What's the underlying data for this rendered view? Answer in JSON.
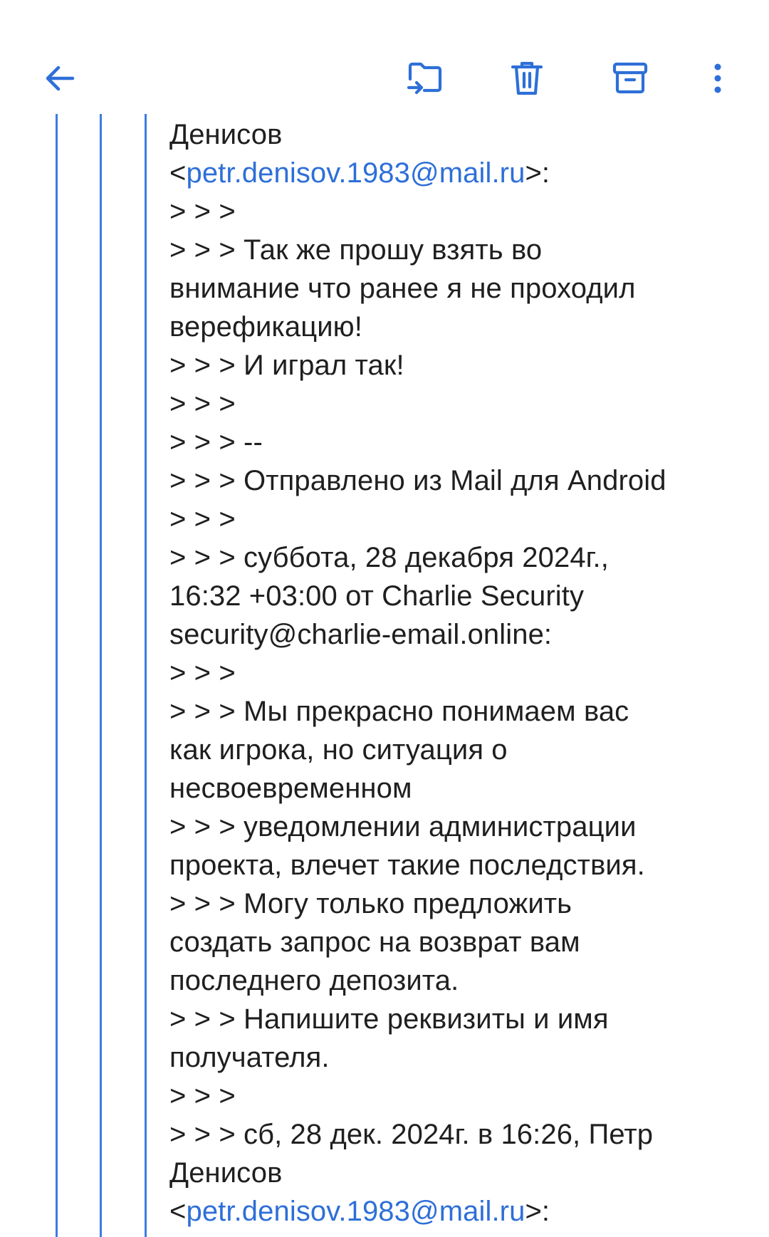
{
  "toolbar": {
    "back_icon": "arrow-left-icon",
    "move_icon": "move-to-folder-icon",
    "delete_icon": "trash-icon",
    "archive_icon": "archive-icon",
    "more_icon": "more-vertical-icon",
    "accent_color": "#2e6fd8"
  },
  "email_body": {
    "lines": [
      {
        "text": "Денисов"
      },
      {
        "pre": "<",
        "link": "petr.denisov.1983@mail.ru",
        "post": ">:"
      },
      {
        "text": "> > >"
      },
      {
        "text": "> > > Так же прошу взять во"
      },
      {
        "text": "внимание что ранее я не проходил"
      },
      {
        "text": "верефикацию!"
      },
      {
        "text": "> > > И играл так!"
      },
      {
        "text": "> > >"
      },
      {
        "text": "> > > --"
      },
      {
        "text": "> > > Отправлено из Mail для Android"
      },
      {
        "text": "> > >"
      },
      {
        "text": "> > > суббота, 28 декабря 2024г.,"
      },
      {
        "text": "16:32 +03:00 от Charlie Security"
      },
      {
        "text": "security@charlie-email.online:"
      },
      {
        "text": "> > >"
      },
      {
        "text": "> > > Мы прекрасно понимаем вас"
      },
      {
        "text": "как игрока, но ситуация о"
      },
      {
        "text": "несвоевременном"
      },
      {
        "text": "> > > уведомлении администрации"
      },
      {
        "text": "проекта, влечет такие последствия."
      },
      {
        "text": "> > > Могу только предложить"
      },
      {
        "text": "создать запрос на возврат вам"
      },
      {
        "text": "последнего депозита."
      },
      {
        "text": "> > > Напишите реквизиты и имя"
      },
      {
        "text": "получателя."
      },
      {
        "text": "> > >"
      },
      {
        "text": "> > > сб, 28 дек. 2024г. в 16:26, Петр"
      },
      {
        "text": "Денисов"
      },
      {
        "pre": "<",
        "link": "petr.denisov.1983@mail.ru",
        "post": ">:"
      }
    ]
  }
}
